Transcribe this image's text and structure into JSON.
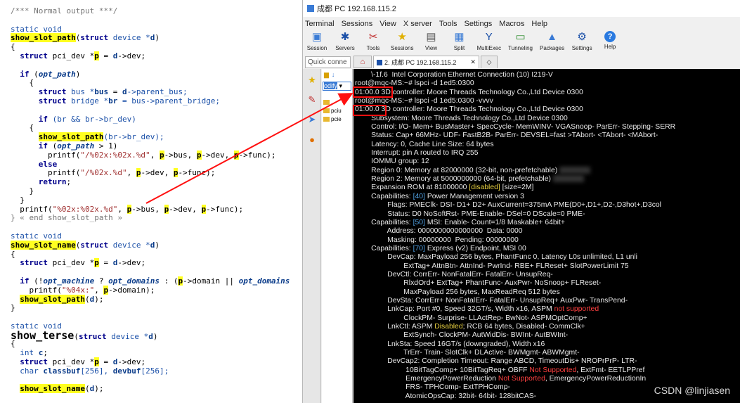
{
  "code": {
    "lines": [
      [
        {
          "t": "/*** Normal output ***/",
          "c": "cm"
        }
      ],
      [
        {
          "t": "",
          "c": ""
        }
      ],
      [
        {
          "t": "static void",
          "c": "ty"
        }
      ],
      [
        {
          "t": "show_slot_path",
          "c": "hlb"
        },
        {
          "t": "(",
          "c": ""
        },
        {
          "t": "struct",
          "c": "k"
        },
        {
          "t": " device *",
          "c": "ty"
        },
        {
          "t": "d",
          "c": "vb"
        },
        {
          "t": ")",
          "c": ""
        }
      ],
      [
        {
          "t": "{",
          "c": ""
        }
      ],
      [
        {
          "t": "  ",
          "c": ""
        },
        {
          "t": "struct",
          "c": "k"
        },
        {
          "t": " pci_dev *",
          "c": ""
        },
        {
          "t": "p",
          "c": "hlb"
        },
        {
          "t": " = ",
          "c": ""
        },
        {
          "t": "d",
          "c": "vb"
        },
        {
          "t": "->dev;",
          "c": ""
        }
      ],
      [
        {
          "t": "",
          "c": ""
        }
      ],
      [
        {
          "t": "  ",
          "c": ""
        },
        {
          "t": "if",
          "c": "k"
        },
        {
          "t": " (",
          "c": ""
        },
        {
          "t": "opt_path",
          "c": "it"
        },
        {
          "t": ")",
          "c": ""
        }
      ],
      [
        {
          "t": "    {",
          "c": ""
        }
      ],
      [
        {
          "t": "      ",
          "c": ""
        },
        {
          "t": "struct",
          "c": "k"
        },
        {
          "t": " bus *",
          "c": "ty"
        },
        {
          "t": "bus",
          "c": "vb"
        },
        {
          "t": " = ",
          "c": ""
        },
        {
          "t": "d",
          "c": "vb"
        },
        {
          "t": "->parent_bus;",
          "c": "ty"
        }
      ],
      [
        {
          "t": "      ",
          "c": ""
        },
        {
          "t": "struct",
          "c": "k"
        },
        {
          "t": " bridge *",
          "c": "ty"
        },
        {
          "t": "br",
          "c": "vb"
        },
        {
          "t": " = bus->parent_bridge;",
          "c": "ty"
        }
      ],
      [
        {
          "t": "",
          "c": ""
        }
      ],
      [
        {
          "t": "      ",
          "c": ""
        },
        {
          "t": "if",
          "c": "k"
        },
        {
          "t": " (br && br->br_dev)",
          "c": "ty"
        }
      ],
      [
        {
          "t": "    {",
          "c": ""
        }
      ],
      [
        {
          "t": "      ",
          "c": ""
        },
        {
          "t": "show_slot_path",
          "c": "hlb"
        },
        {
          "t": "(br->br_dev);",
          "c": "ty"
        }
      ],
      [
        {
          "t": "      ",
          "c": ""
        },
        {
          "t": "if",
          "c": "k"
        },
        {
          "t": " (",
          "c": ""
        },
        {
          "t": "opt_path",
          "c": "it"
        },
        {
          "t": " > 1)",
          "c": ""
        }
      ],
      [
        {
          "t": "        printf(",
          "c": ""
        },
        {
          "t": "\"/%02x:%02x.%d\"",
          "c": "nm"
        },
        {
          "t": ", ",
          "c": ""
        },
        {
          "t": "p",
          "c": "hlb"
        },
        {
          "t": "->bus, ",
          "c": ""
        },
        {
          "t": "p",
          "c": "hlb"
        },
        {
          "t": "->dev, ",
          "c": ""
        },
        {
          "t": "p",
          "c": "hlb"
        },
        {
          "t": "->func);",
          "c": ""
        }
      ],
      [
        {
          "t": "      ",
          "c": ""
        },
        {
          "t": "else",
          "c": "k"
        }
      ],
      [
        {
          "t": "        printf(",
          "c": ""
        },
        {
          "t": "\"/%02x.%d\"",
          "c": "nm"
        },
        {
          "t": ", ",
          "c": ""
        },
        {
          "t": "p",
          "c": "hlb"
        },
        {
          "t": "->dev, ",
          "c": ""
        },
        {
          "t": "p",
          "c": "hlb"
        },
        {
          "t": "->func);",
          "c": ""
        }
      ],
      [
        {
          "t": "      ",
          "c": ""
        },
        {
          "t": "return",
          "c": "k"
        },
        {
          "t": ";",
          "c": ""
        }
      ],
      [
        {
          "t": "    }",
          "c": ""
        }
      ],
      [
        {
          "t": "  }",
          "c": ""
        }
      ],
      [
        {
          "t": "  printf(",
          "c": ""
        },
        {
          "t": "\"%02x:%02x.%d\"",
          "c": "nm"
        },
        {
          "t": ", ",
          "c": ""
        },
        {
          "t": "p",
          "c": "hlb"
        },
        {
          "t": "->bus, ",
          "c": ""
        },
        {
          "t": "p",
          "c": "hlb"
        },
        {
          "t": "->dev, ",
          "c": ""
        },
        {
          "t": "p",
          "c": "hlb"
        },
        {
          "t": "->func);",
          "c": ""
        }
      ],
      [
        {
          "t": "} « end show_slot_path »",
          "c": "cm"
        }
      ],
      [
        {
          "t": "",
          "c": ""
        }
      ],
      [
        {
          "t": "static void",
          "c": "ty"
        }
      ],
      [
        {
          "t": "show_slot_name",
          "c": "hlb"
        },
        {
          "t": "(",
          "c": ""
        },
        {
          "t": "struct",
          "c": "k"
        },
        {
          "t": " device *",
          "c": "ty"
        },
        {
          "t": "d",
          "c": "vb"
        },
        {
          "t": ")",
          "c": ""
        }
      ],
      [
        {
          "t": "{",
          "c": ""
        }
      ],
      [
        {
          "t": "  ",
          "c": ""
        },
        {
          "t": "struct",
          "c": "k"
        },
        {
          "t": " pci_dev *",
          "c": ""
        },
        {
          "t": "p",
          "c": "hlb"
        },
        {
          "t": " = ",
          "c": ""
        },
        {
          "t": "d",
          "c": "vb"
        },
        {
          "t": "->dev;",
          "c": ""
        }
      ],
      [
        {
          "t": "",
          "c": ""
        }
      ],
      [
        {
          "t": "  ",
          "c": ""
        },
        {
          "t": "if",
          "c": "k"
        },
        {
          "t": " (!",
          "c": ""
        },
        {
          "t": "opt_machine",
          "c": "it"
        },
        {
          "t": " ? ",
          "c": ""
        },
        {
          "t": "opt_domains",
          "c": "it"
        },
        {
          "t": " : (",
          "c": ""
        },
        {
          "t": "p",
          "c": "hlb"
        },
        {
          "t": "->domain || ",
          "c": ""
        },
        {
          "t": "opt_domains",
          "c": "it"
        }
      ],
      [
        {
          "t": "    printf(",
          "c": ""
        },
        {
          "t": "\"%04x:\"",
          "c": "nm"
        },
        {
          "t": ", ",
          "c": ""
        },
        {
          "t": "p",
          "c": "hlb"
        },
        {
          "t": "->domain);",
          "c": ""
        }
      ],
      [
        {
          "t": "  ",
          "c": ""
        },
        {
          "t": "show_slot_path",
          "c": "hlb"
        },
        {
          "t": "(",
          "c": ""
        },
        {
          "t": "d",
          "c": "vb"
        },
        {
          "t": ");",
          "c": ""
        }
      ],
      [
        {
          "t": "}",
          "c": ""
        }
      ],
      [
        {
          "t": "",
          "c": ""
        }
      ],
      [
        {
          "t": "static void",
          "c": "ty"
        }
      ],
      [
        {
          "t": "show_terse",
          "c": "bg"
        },
        {
          "t": "(",
          "c": ""
        },
        {
          "t": "struct",
          "c": "k"
        },
        {
          "t": " device *",
          "c": "ty"
        },
        {
          "t": "d",
          "c": "vb"
        },
        {
          "t": ")",
          "c": ""
        }
      ],
      [
        {
          "t": "{",
          "c": ""
        }
      ],
      [
        {
          "t": "  int ",
          "c": "ty"
        },
        {
          "t": "c",
          "c": "vb"
        },
        {
          "t": ";",
          "c": ""
        }
      ],
      [
        {
          "t": "  ",
          "c": ""
        },
        {
          "t": "struct",
          "c": "k"
        },
        {
          "t": " pci_dev *",
          "c": ""
        },
        {
          "t": "p",
          "c": "hlb"
        },
        {
          "t": " = ",
          "c": ""
        },
        {
          "t": "d",
          "c": "vb"
        },
        {
          "t": "->dev;",
          "c": ""
        }
      ],
      [
        {
          "t": "  char ",
          "c": "ty"
        },
        {
          "t": "classbuf",
          "c": "vb"
        },
        {
          "t": "[256], ",
          "c": "ty"
        },
        {
          "t": "devbuf",
          "c": "vb"
        },
        {
          "t": "[256];",
          "c": "ty"
        }
      ],
      [
        {
          "t": "",
          "c": ""
        }
      ],
      [
        {
          "t": "  ",
          "c": ""
        },
        {
          "t": "show_slot_name",
          "c": "hlb"
        },
        {
          "t": "(",
          "c": ""
        },
        {
          "t": "d",
          "c": "vb"
        },
        {
          "t": ");",
          "c": ""
        }
      ]
    ]
  },
  "mobaxterm": {
    "window_title": "成都 PC 192.168.115.2",
    "menu": [
      "Terminal",
      "Sessions",
      "View",
      "X server",
      "Tools",
      "Settings",
      "Macros",
      "Help"
    ],
    "tools": [
      {
        "label": "Session",
        "icon": "session-icon"
      },
      {
        "label": "Servers",
        "icon": "servers-icon"
      },
      {
        "label": "Tools",
        "icon": "tools-icon"
      },
      {
        "label": "Sessions",
        "icon": "sessions-icon"
      },
      {
        "label": "View",
        "icon": "view-icon"
      },
      {
        "label": "Split",
        "icon": "split-icon"
      },
      {
        "label": "MultiExec",
        "icon": "multiexec-icon"
      },
      {
        "label": "Tunneling",
        "icon": "tunneling-icon"
      },
      {
        "label": "Packages",
        "icon": "packages-icon"
      },
      {
        "label": "Settings",
        "icon": "settings-icon"
      },
      {
        "label": "Help",
        "icon": "help-icon"
      }
    ],
    "quick_connect_placeholder": "Quick conne",
    "tab_label": "2. 成都 PC 192.168.115.2",
    "file_select": "odify",
    "files": [
      "..",
      "pciu",
      "pcie"
    ]
  },
  "terminal": {
    "lines": [
      [
        {
          "t": "        \\-1f.6  Intel Corporation Ethernet Connection (10) I219-V",
          "c": ""
        }
      ],
      [
        {
          "t": "root@mqc-MS:~# lspci -d 1ed5:0300",
          "c": ""
        }
      ],
      [
        {
          "t": "01:00.0 3D controller: Moore Threads Technology Co.,Ltd Device 0300",
          "c": ""
        }
      ],
      [
        {
          "t": "root@mqc-MS:~# lspci -d 1ed5:0300 -vvvv",
          "c": ""
        }
      ],
      [
        {
          "t": "01:00.0 3D controller: Moore Threads Technology Co.,Ltd Device 0300",
          "c": ""
        }
      ],
      [
        {
          "t": "        Subsystem: Moore Threads Technology Co.,Ltd Device 0300",
          "c": ""
        }
      ],
      [
        {
          "t": "        Control: I/O- Mem+ BusMaster+ SpecCycle- MemWINV- VGASnoop- ParErr- Stepping- SERR",
          "c": ""
        }
      ],
      [
        {
          "t": "        Status: Cap+ 66MHz- UDF- FastB2B- ParErr- DEVSEL=fast >TAbort- <TAbort- <MAbort-",
          "c": ""
        }
      ],
      [
        {
          "t": "        Latency: 0, Cache Line Size: 64 bytes",
          "c": ""
        }
      ],
      [
        {
          "t": "        Interrupt: pin A routed to IRQ 255",
          "c": ""
        }
      ],
      [
        {
          "t": "        IOMMU group: 12",
          "c": ""
        }
      ],
      [
        {
          "t": "        Region 0: Memory at 82000000 (32-bit, non-prefetchable) ",
          "c": ""
        },
        {
          "t": "",
          "c": "blur"
        }
      ],
      [
        {
          "t": "        Region 2: Memory at 5000000000 (64-bit, prefetchable) ",
          "c": ""
        },
        {
          "t": "",
          "c": "blur"
        }
      ],
      [
        {
          "t": "        Expansion ROM at 81000000 ",
          "c": ""
        },
        {
          "t": "[disabled]",
          "c": "ty2"
        },
        {
          "t": " [size=2M]",
          "c": ""
        }
      ],
      [
        {
          "t": "        Capabilities: ",
          "c": ""
        },
        {
          "t": "[40]",
          "c": "tb"
        },
        {
          "t": " Power Management version 3",
          "c": ""
        }
      ],
      [
        {
          "t": "                Flags: PMEClk- DSI- D1+ D2+ AuxCurrent=375mA PME(D0+,D1+,D2-,D3hot+,D3col",
          "c": ""
        }
      ],
      [
        {
          "t": "                Status: D0 NoSoftRst- PME-Enable- DSel=0 DScale=0 PME-",
          "c": ""
        }
      ],
      [
        {
          "t": "        Capabilities: ",
          "c": ""
        },
        {
          "t": "[50]",
          "c": "tb"
        },
        {
          "t": " MSI: Enable- Count=1/8 Maskable+ 64bit+",
          "c": ""
        }
      ],
      [
        {
          "t": "                Address: 0000000000000000  Data: 0000",
          "c": ""
        }
      ],
      [
        {
          "t": "                Masking: 00000000  Pending: 00000000",
          "c": ""
        }
      ],
      [
        {
          "t": "        Capabilities: ",
          "c": ""
        },
        {
          "t": "[70]",
          "c": "tb"
        },
        {
          "t": " Express (v2) Endpoint, MSI 00",
          "c": ""
        }
      ],
      [
        {
          "t": "                DevCap: MaxPayload 256 bytes, PhantFunc 0, Latency L0s unlimited, L1 unli",
          "c": ""
        }
      ],
      [
        {
          "t": "                        ExtTag+ AttnBtn- AttnInd- PwrInd- RBE+ FLReset+ SlotPowerLimit 75",
          "c": ""
        }
      ],
      [
        {
          "t": "                DevCtl: CorrErr- NonFatalErr- FatalErr- UnsupReq-",
          "c": ""
        }
      ],
      [
        {
          "t": "                        RlxdOrd+ ExtTag+ PhantFunc- AuxPwr- NoSnoop+ FLReset-",
          "c": ""
        }
      ],
      [
        {
          "t": "                        MaxPayload 256 bytes, MaxReadReq 512 bytes",
          "c": ""
        }
      ],
      [
        {
          "t": "                DevSta: CorrErr+ NonFatalErr- FatalErr- UnsupReq+ AuxPwr- TransPend-",
          "c": ""
        }
      ],
      [
        {
          "t": "                LnkCap: Port #0, Speed 32GT/s, Width x16, ASPM ",
          "c": ""
        },
        {
          "t": "not supported",
          "c": "tr"
        }
      ],
      [
        {
          "t": "                        ClockPM- Surprise- LLActRep- BwNot- ASPMOptComp+",
          "c": ""
        }
      ],
      [
        {
          "t": "                LnkCtl: ASPM ",
          "c": ""
        },
        {
          "t": "Disabled",
          "c": "ty2"
        },
        {
          "t": "; RCB 64 bytes, Disabled- CommClk+",
          "c": ""
        }
      ],
      [
        {
          "t": "                        ExtSynch- ClockPM- AutWidDis- BWInt- AutBWInt-",
          "c": ""
        }
      ],
      [
        {
          "t": "                LnkSta: Speed 16GT/s (downgraded), Width x16",
          "c": ""
        }
      ],
      [
        {
          "t": "                        TrErr- Train- SlotClk+ DLActive- BWMgmt- ABWMgmt-",
          "c": ""
        }
      ],
      [
        {
          "t": "                DevCap2: Completion Timeout: Range ABCD, TimeoutDis+ NROPrPrP- LTR-",
          "c": ""
        }
      ],
      [
        {
          "t": "                         10BitTagComp+ 10BitTagReq+ OBFF ",
          "c": ""
        },
        {
          "t": "Not Supported",
          "c": "tr"
        },
        {
          "t": ", ExtFmt- EETLPPref",
          "c": ""
        }
      ],
      [
        {
          "t": "                         EmergencyPowerReduction ",
          "c": ""
        },
        {
          "t": "Not Supported",
          "c": "tr"
        },
        {
          "t": ", EmergencyPowerReductionIn",
          "c": ""
        }
      ],
      [
        {
          "t": "                         FRS- TPHComp- ExtTPHComp-",
          "c": ""
        }
      ],
      [
        {
          "t": "                         AtomicOpsCap: 32bit- 64bit- 128bitCAS-",
          "c": ""
        }
      ]
    ]
  },
  "watermark": "CSDN @linjiasen",
  "colors": {
    "annotation": "#ff1010",
    "highlight": "#ffff20",
    "terminal_bg": "#000000"
  }
}
